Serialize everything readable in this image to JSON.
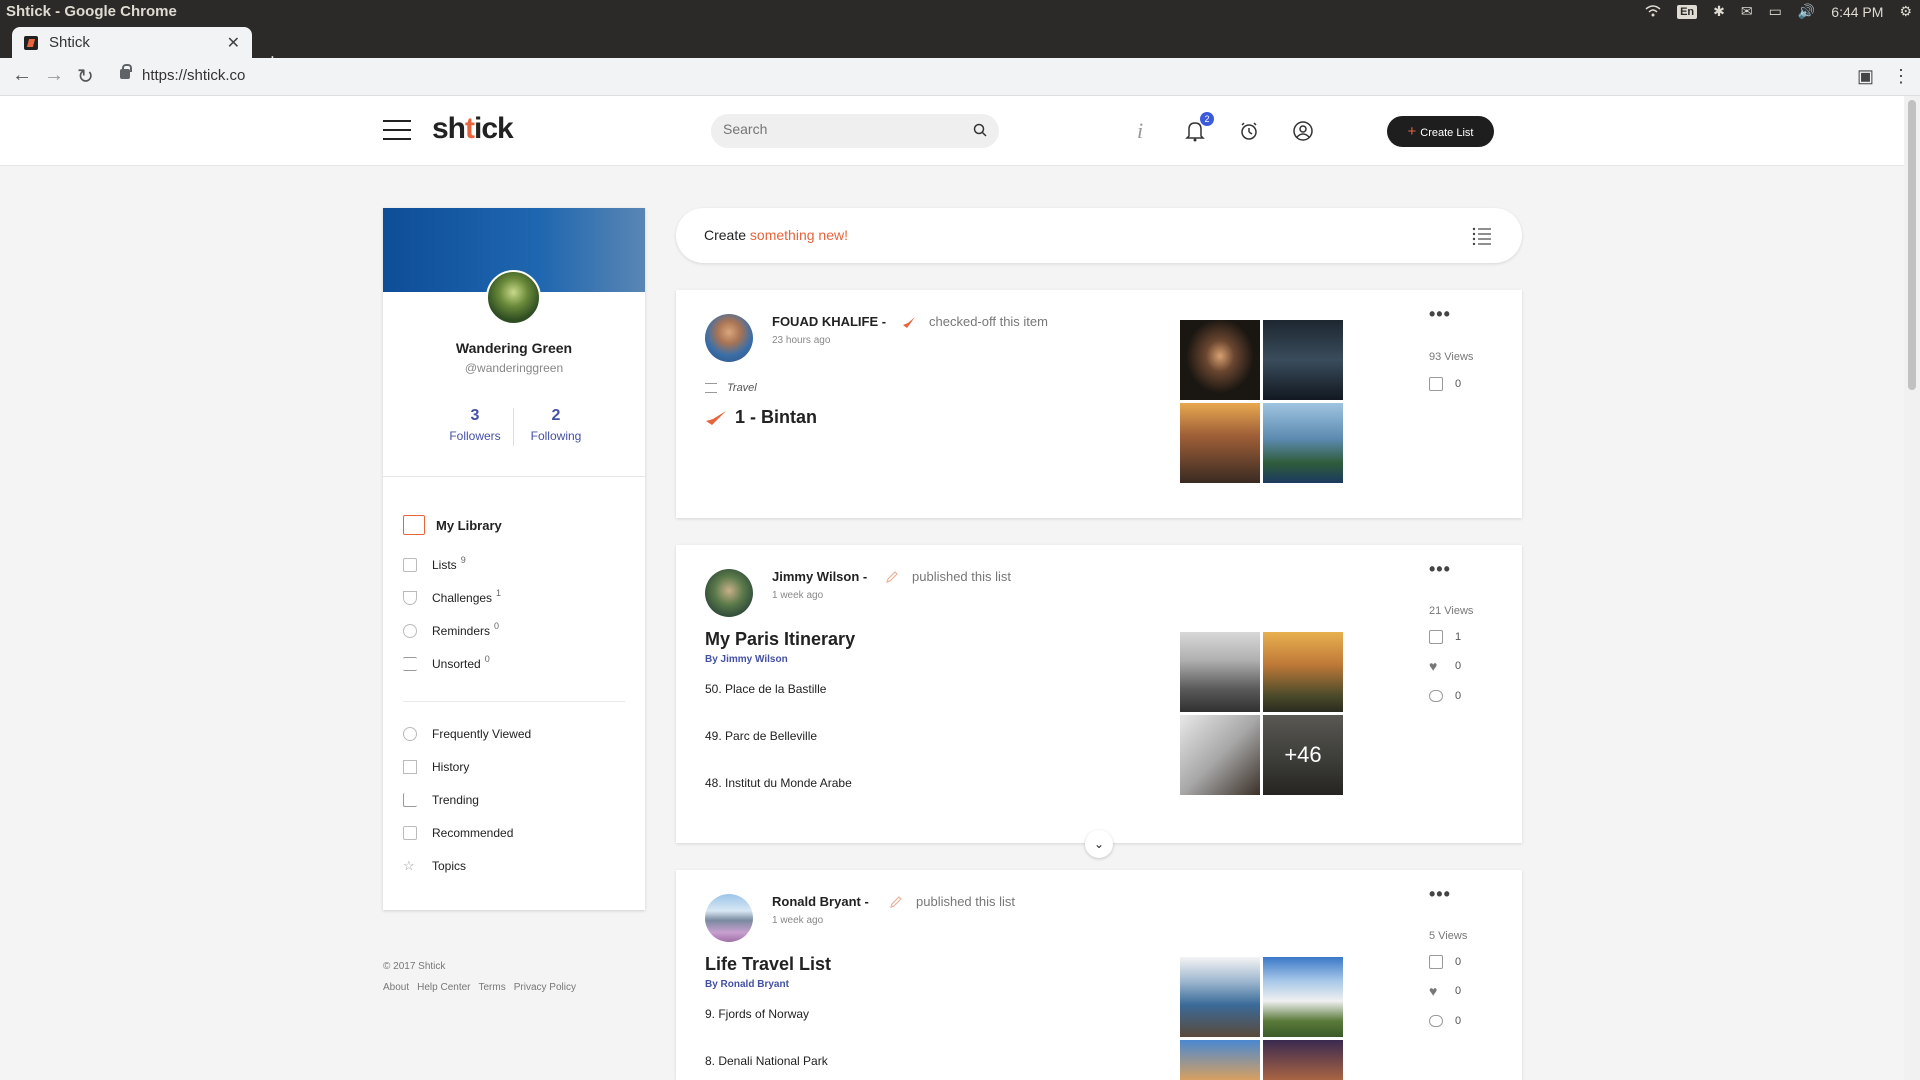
{
  "os": {
    "window_title": "Shtick - Google Chrome",
    "lang": "En",
    "clock": "6:44 PM"
  },
  "browser": {
    "tab_title": "Shtick",
    "url": "https://shtick.co"
  },
  "header": {
    "logo_pre": "sh",
    "logo_accent": "t",
    "logo_post": "ick",
    "search_placeholder": "Search",
    "notification_count": "2",
    "create_list_label": "Create List"
  },
  "profile": {
    "name": "Wandering Green",
    "handle": "@wanderinggreen",
    "followers_count": "3",
    "followers_label": "Followers",
    "following_count": "2",
    "following_label": "Following",
    "library_label": "My Library",
    "library_items": [
      {
        "label": "Lists",
        "count": "9"
      },
      {
        "label": "Challenges",
        "count": "1"
      },
      {
        "label": "Reminders",
        "count": "0"
      },
      {
        "label": "Unsorted",
        "count": "0"
      }
    ],
    "nav_items": [
      {
        "label": "Frequently Viewed"
      },
      {
        "label": "History"
      },
      {
        "label": "Trending"
      },
      {
        "label": "Recommended"
      },
      {
        "label": "Topics"
      }
    ]
  },
  "footer": {
    "copyright": "© 2017 Shtick",
    "links": [
      "About",
      "Help Center",
      "Terms",
      "Privacy Policy"
    ]
  },
  "create_bar": {
    "prefix": "Create",
    "accent": "something new!"
  },
  "feed": [
    {
      "author": "FOUAD KHALIFE -",
      "action": "checked-off this item",
      "time": "23 hours ago",
      "topic": "Travel",
      "item_title": "1 - Bintan",
      "views": "93 Views",
      "added": "0"
    },
    {
      "author": "Jimmy Wilson -",
      "action": "published this list",
      "time": "1 week ago",
      "title": "My Paris Itinerary",
      "by": "By Jimmy Wilson",
      "items": [
        "50. Place de la Bastille",
        "49. Parc de Belleville",
        "48. Institut du Monde Arabe"
      ],
      "views": "21 Views",
      "added": "1",
      "likes": "0",
      "comments": "0",
      "more_photos": "+46"
    },
    {
      "author": "Ronald Bryant -",
      "action": "published this list",
      "time": "1 week ago",
      "title": "Life Travel List",
      "by": "By Ronald Bryant",
      "items": [
        "9. Fjords of Norway",
        "8. Denali National Park"
      ],
      "views": "5 Views",
      "added": "0",
      "likes": "0",
      "comments": "0"
    }
  ],
  "colors": {
    "accent": "#e8643c",
    "link": "#4451a3",
    "badge": "#3b5bdb"
  }
}
